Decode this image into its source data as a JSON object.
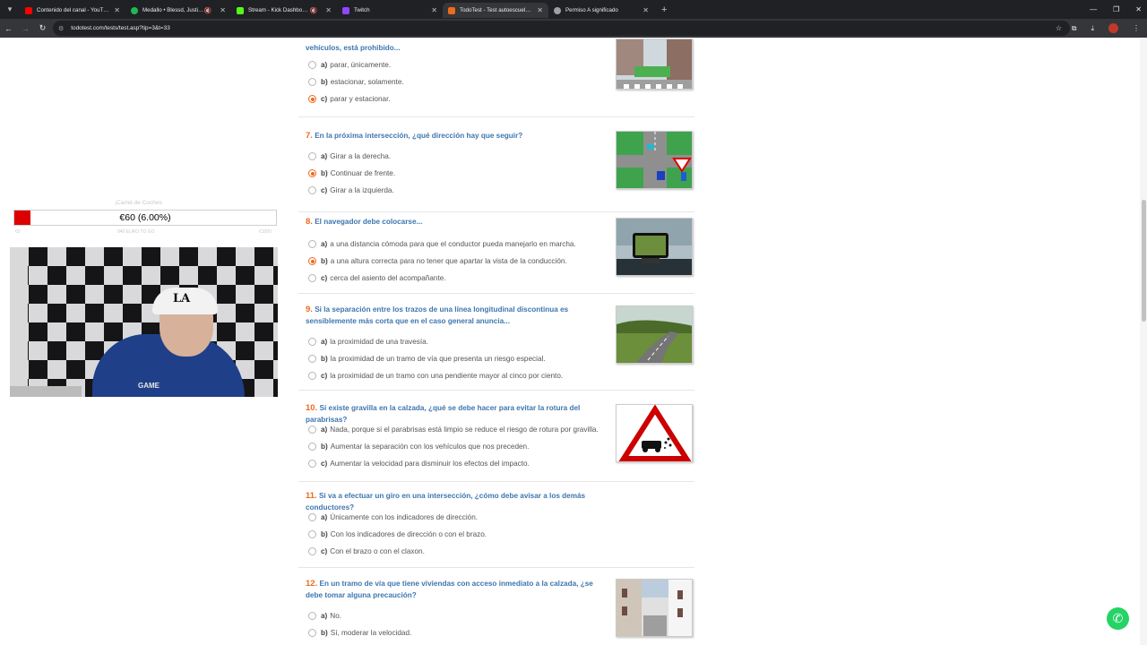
{
  "browser": {
    "tabs": [
      {
        "title": "Contenido del canal - YouTube",
        "favicon_color": "#ff0000",
        "active": false,
        "muted": false
      },
      {
        "title": "Medallo • Blessd, Justin Qu...",
        "favicon_color": "#1db954",
        "active": false,
        "muted": true
      },
      {
        "title": "Stream - Kick Dashboard",
        "favicon_color": "#53fc18",
        "active": false,
        "muted": true
      },
      {
        "title": "Twitch",
        "favicon_color": "#9146ff",
        "active": false,
        "muted": false
      },
      {
        "title": "TodoTest - Test autoescuela gra...",
        "favicon_color": "#ef6a1b",
        "active": true,
        "muted": false
      },
      {
        "title": "Permiso A significado",
        "favicon_color": "#9aa0a6",
        "active": false,
        "muted": false
      }
    ],
    "url": "todotest.com/tests/test.asp?tip=3&t=33"
  },
  "goal": {
    "title": "¡Carné de Coches",
    "amount_label": "€60 (6.00%)",
    "progress": 0.06,
    "min_label": "€0",
    "to_go_label": "940 EURO TO GO",
    "max_label": "€1000",
    "fill_color": "#dd0000"
  },
  "webcam": {
    "cap_logo": "LA",
    "shirt_text": "GAME"
  },
  "questions": [
    {
      "number": "",
      "text": "vehículos, está prohibido...",
      "answers": [
        {
          "letter": "a)",
          "text": "parar, únicamente.",
          "selected": false
        },
        {
          "letter": "b)",
          "text": "estacionar, solamente.",
          "selected": false
        },
        {
          "letter": "c)",
          "text": "parar y estacionar.",
          "selected": true
        }
      ],
      "image": "crosswalk-street-photo"
    },
    {
      "number": "7.",
      "text": "En la próxima intersección, ¿qué dirección hay que seguir?",
      "answers": [
        {
          "letter": "a)",
          "text": "Girar a la derecha.",
          "selected": false
        },
        {
          "letter": "b)",
          "text": "Continuar de frente.",
          "selected": true
        },
        {
          "letter": "c)",
          "text": "Girar a la izquierda.",
          "selected": false
        }
      ],
      "image": "intersection-diagram"
    },
    {
      "number": "8.",
      "text": "El navegador debe colocarse...",
      "answers": [
        {
          "letter": "a)",
          "text": "a una distancia cómoda para que el conductor pueda manejarlo en marcha.",
          "selected": false
        },
        {
          "letter": "b)",
          "text": "a una altura correcta para no tener que apartar la vista de la conducción.",
          "selected": true
        },
        {
          "letter": "c)",
          "text": "cerca del asiento del acompañante.",
          "selected": false
        }
      ],
      "image": "gps-navigator-photo"
    },
    {
      "number": "9.",
      "text": "Si la separación entre los trazos de una línea longitudinal discontinua es sensiblemente más corta que en el caso general anuncia...",
      "answers": [
        {
          "letter": "a)",
          "text": "la proximidad de una travesía.",
          "selected": false
        },
        {
          "letter": "b)",
          "text": "la proximidad de un tramo de vía que presenta un riesgo especial.",
          "selected": false
        },
        {
          "letter": "c)",
          "text": "la proximidad de un tramo con una pendiente mayor al cinco por ciento.",
          "selected": false
        }
      ],
      "image": "mountain-road-photo"
    },
    {
      "number": "10.",
      "text": "Si existe gravilla en la calzada, ¿qué se debe hacer para evitar la rotura del parabrisas?",
      "answers": [
        {
          "letter": "a)",
          "text": "Nada, porque si el parabrisas está limpio se reduce el riesgo de rotura por gravilla.",
          "selected": false
        },
        {
          "letter": "b)",
          "text": "Aumentar la separación con los vehículos que nos preceden.",
          "selected": false
        },
        {
          "letter": "c)",
          "text": "Aumentar la velocidad para disminuir los efectos del impacto.",
          "selected": false
        }
      ],
      "image": "loose-gravel-warning-sign"
    },
    {
      "number": "11.",
      "text": "Si va a efectuar un giro en una intersección, ¿cómo debe avisar a los demás conductores?",
      "answers": [
        {
          "letter": "a)",
          "text": "Únicamente con los indicadores de dirección.",
          "selected": false
        },
        {
          "letter": "b)",
          "text": "Con los indicadores de dirección o con el brazo.",
          "selected": false
        },
        {
          "letter": "c)",
          "text": "Con el brazo o con el claxon.",
          "selected": false
        }
      ],
      "image": ""
    },
    {
      "number": "12.",
      "text": "En un tramo de vía que tiene viviendas con acceso inmediato a la calzada, ¿se debe tomar alguna precaución?",
      "answers": [
        {
          "letter": "a)",
          "text": "No.",
          "selected": false
        },
        {
          "letter": "b)",
          "text": "Sí, moderar la velocidad.",
          "selected": false
        }
      ],
      "image": "narrow-village-street-photo"
    }
  ],
  "colors": {
    "accent": "#ef6a1b",
    "question": "#3d76b0",
    "whatsapp": "#25d366"
  }
}
